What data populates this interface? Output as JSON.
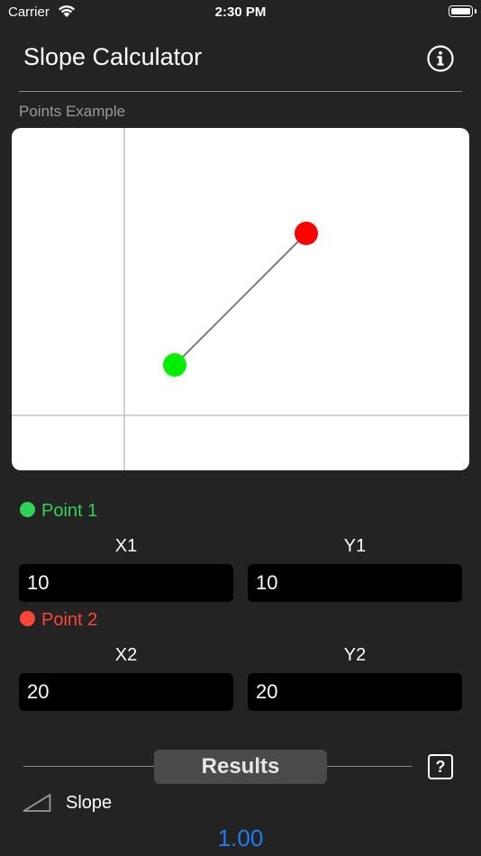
{
  "status_bar": {
    "carrier": "Carrier",
    "time": "2:30 PM",
    "wifi_icon": "wifi-icon",
    "battery_icon": "battery-icon"
  },
  "nav": {
    "title": "Slope Calculator",
    "info_icon": "info-circle-icon"
  },
  "example": {
    "label": "Points Example"
  },
  "point1": {
    "label": "Point 1",
    "color": "#30d158",
    "x_label": "X1",
    "y_label": "Y1",
    "x_value": "10",
    "y_value": "10"
  },
  "point2": {
    "label": "Point 2",
    "color": "#ff453a",
    "x_label": "X2",
    "y_label": "Y2",
    "x_value": "20",
    "y_value": "20"
  },
  "results": {
    "button_label": "Results",
    "help_label": "?",
    "slope_icon": "slope-triangle-icon",
    "slope_label": "Slope",
    "slope_value": "1.00",
    "value_color": "#1e7bf2"
  }
}
